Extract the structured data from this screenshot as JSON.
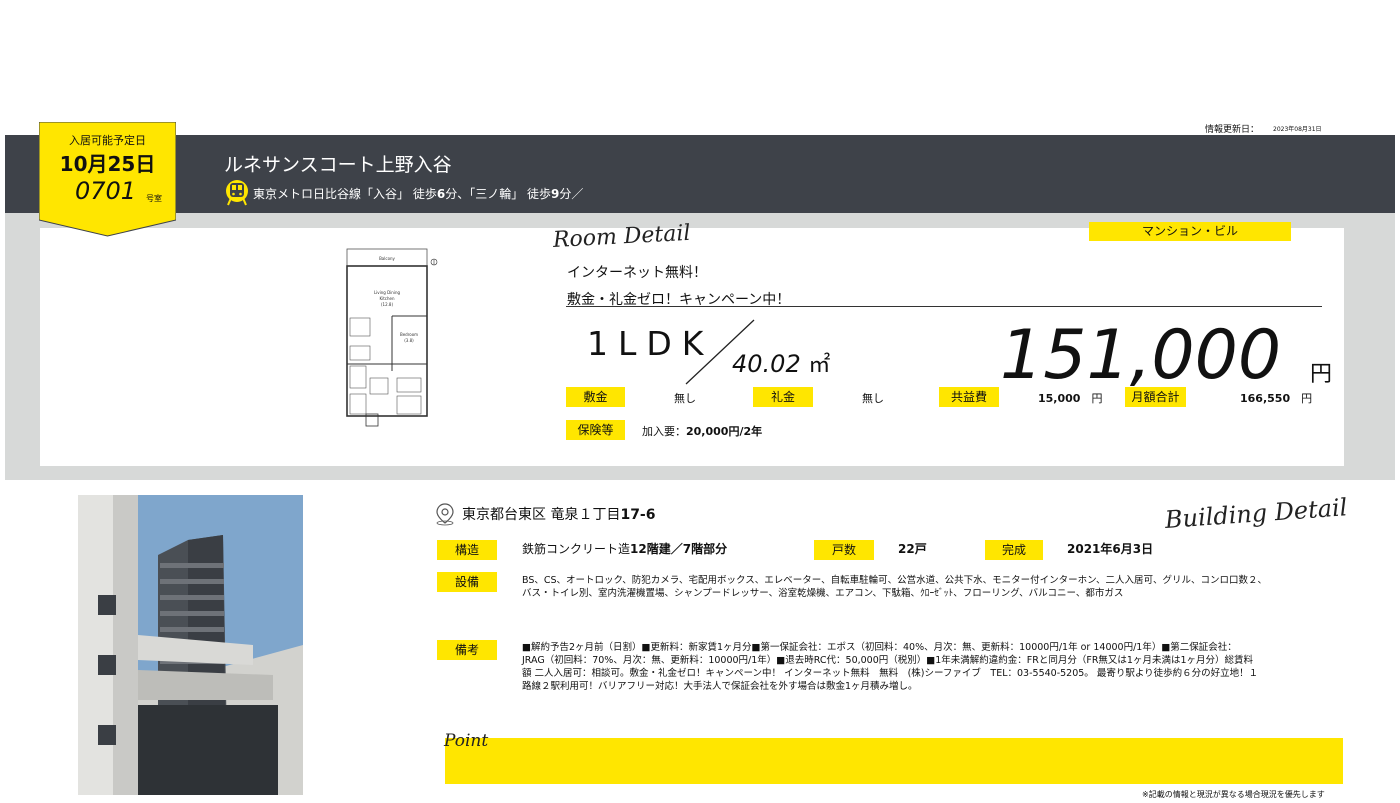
{
  "info_update": {
    "label": "情報更新日：",
    "date": "2023年08月31日"
  },
  "badge": {
    "label": "入居可能予定日",
    "date": "10月25日",
    "room": "0701",
    "room_suffix": "号室"
  },
  "property": {
    "name": "ルネサンスコート上野入谷"
  },
  "access": {
    "icon": "train-icon",
    "text_a": "東京メトロ日比谷線「入谷」 徒歩",
    "min_a": "6",
    "text_b": "分、「三ノ輪」 徒歩",
    "min_b": "9",
    "text_c": "分／"
  },
  "room_detail": {
    "title": "Room Detail",
    "type_tag": "マンション・ビル",
    "feature_1": "インターネット無料！",
    "feature_2": "敷金・礼金ゼロ！キャンペーン中！",
    "layout": "1LDK",
    "area": "40.02",
    "area_unit": "㎡",
    "rent": "151,000",
    "rent_unit": "円",
    "deposit_label": "敷金",
    "deposit": "無し",
    "key_money_label": "礼金",
    "key_money": "無し",
    "maintenance_label": "共益費",
    "maintenance": "15,000",
    "maintenance_unit": "円",
    "total_label": "月額合計",
    "total": "166,550",
    "total_unit": "円",
    "insurance_label": "保険等",
    "insurance_prefix": "加入要：",
    "insurance_value": "20,000円/2年"
  },
  "floorplan": {
    "balcony": "Balcony",
    "ldk": "Living Dining",
    "ldk_2": "Kitchen",
    "ldk_size": "(12.8)",
    "bedroom": "Bedroom",
    "bedroom_size": "(3.8)"
  },
  "building": {
    "address_prefix": "東京都台東区 竜泉１丁目",
    "address_num": "17-6",
    "title": "Building Detail",
    "structure_label": "構造",
    "structure_a": "鉄筋コンクリート造",
    "structure_b": "12階建／7階部分",
    "units_label": "戸数",
    "units": "22戸",
    "completed_label": "完成",
    "completed": "2021年6月3日",
    "equipment_label": "設備",
    "equipment_1": "BS、CS、オートロック、防犯カメラ、宅配用ボックス、エレベーター、自転車駐輪可、公営水道、公共下水、モニター付インターホン、二人入居可、グリル、コンロ口数２、",
    "equipment_2": "バス・トイレ別、室内洗濯機置場、シャンプードレッサー、浴室乾燥機、エアコン、下駄箱、ｸﾛｰｾﾞｯﾄ、フローリング、バルコニー、都市ガス",
    "remarks_label": "備考",
    "remarks_1": "■解約予告2ヶ月前（日割）■更新料：新家賃1ヶ月分■第一保証会社：エポス（初回料：40%、月次：無、更新料：10000円/1年 or 14000円/1年）■第二保証会社：",
    "remarks_2": "JRAG（初回料：70%、月次：無、更新料：10000円/1年）■退去時RC代：50,000円（税別）■1年未満解約違約金：FRと同月分（FR無又は1ヶ月未満は1ヶ月分）総賃料",
    "remarks_3": "額 二人入居可：相談可。敷金・礼金ゼロ！キャンペーン中！ インターネット無料　無料　(株)シーファイブ　TEL：03-5540-5205。 最寄り駅より徒歩約６分の好立地！１",
    "remarks_4": "路線２駅利用可！バリアフリー対応！大手法人で保証会社を外す場合は敷金1ヶ月積み増し。"
  },
  "point": {
    "title": "Point"
  },
  "footnote": "※記載の情報と現況が異なる場合現況を優先します",
  "colors": {
    "accent": "#ffe600",
    "header": "#3e4249",
    "band": "#d7d9d8"
  }
}
